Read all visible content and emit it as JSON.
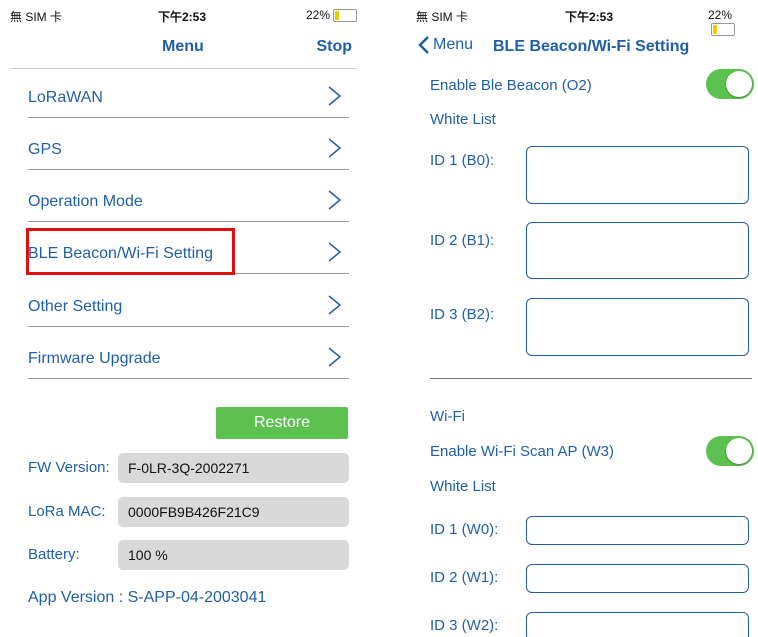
{
  "left": {
    "status": {
      "carrier": "無 SIM 卡",
      "time": "下午2:53",
      "battery": "22%",
      "battery_level": 0.22
    },
    "nav": {
      "title": "Menu",
      "stop": "Stop"
    },
    "menu_items": [
      "LoRaWAN",
      "GPS",
      "Operation Mode",
      "BLE Beacon/Wi-Fi Setting",
      "Other Setting",
      "Firmware Upgrade"
    ],
    "restore_label": "Restore",
    "fw_label": "FW Version:",
    "fw_value": "F-0LR-3Q-2002271",
    "mac_label": "LoRa MAC:",
    "mac_value": "0000FB9B426F21C9",
    "battery_label": "Battery:",
    "battery_value": "100 %",
    "app_version": "App Version : S-APP-04-2003041"
  },
  "right": {
    "status": {
      "carrier": "無 SIM 卡",
      "time": "下午2:53",
      "battery": "22%",
      "battery_level": 0.22
    },
    "nav": {
      "back": "Menu",
      "title": "BLE Beacon/Wi-Fi Setting"
    },
    "ble_enable_label": "Enable Ble Beacon (O2)",
    "ble_white_list": "White List",
    "ble_ids": [
      "ID 1 (B0):",
      "ID 2 (B1):",
      "ID 3 (B2):"
    ],
    "wifi_header": "Wi-Fi",
    "wifi_enable_label": "Enable Wi-Fi Scan AP (W3)",
    "wifi_white_list": "White List",
    "wifi_ids": [
      "ID 1 (W0):",
      "ID 2 (W1):",
      "ID 3 (W2):"
    ],
    "ble_enabled": true,
    "wifi_enabled": true
  },
  "colors": {
    "accent": "#1f5fa6",
    "toggle_on": "#5cc14e",
    "highlight": "#e01010"
  }
}
